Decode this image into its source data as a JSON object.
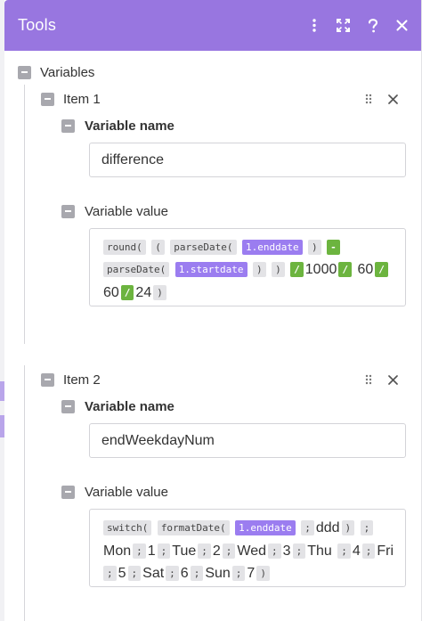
{
  "header": {
    "title": "Tools"
  },
  "variables_label": "Variables",
  "items": [
    {
      "title": "Item 1",
      "name_label": "Variable name",
      "name_value": "difference",
      "value_label": "Variable value",
      "tokens": {
        "t0": "round(",
        "t1": "(",
        "t2": "parseDate(",
        "t3": "1.enddate",
        "t4": ")",
        "t5": "-",
        "t6": "parseDate(",
        "t7": "1.startdate",
        "t8": ")",
        "t9": ")",
        "t10": "/",
        "t11": "1000",
        "t12": "/",
        "t13": "60",
        "t14": "/",
        "t15": "60",
        "t16": "/",
        "t17": "24",
        "t18": ")"
      }
    },
    {
      "title": "Item 2",
      "name_label": "Variable name",
      "name_value": "endWeekdayNum",
      "value_label": "Variable value",
      "tokens": {
        "t0": "switch(",
        "t1": "formatDate(",
        "t2": "1.enddate",
        "t3": ";",
        "t4": "ddd",
        "t5": ")",
        "t6": ";",
        "t7": "Mon",
        "t8": ";",
        "t9": "1",
        "t10": ";",
        "t11": "Tue",
        "t12": ";",
        "t13": "2",
        "t14": ";",
        "t15": "Wed",
        "t16": ";",
        "t17": "3",
        "t18": ";",
        "t19": "Thu",
        "t20": ";",
        "t21": "4",
        "t22": ";",
        "t23": "Fri",
        "t24": ";",
        "t25": "5",
        "t26": ";",
        "t27": "Sat",
        "t28": ";",
        "t29": "6",
        "t30": ";",
        "t31": "Sun",
        "t32": ";",
        "t33": "7",
        "t34": ")"
      }
    }
  ],
  "colors": {
    "header": "#9876e0",
    "variable_token": "#9b7df0",
    "operator_token": "#6cb43f",
    "function_token": "#e3e3e6"
  }
}
